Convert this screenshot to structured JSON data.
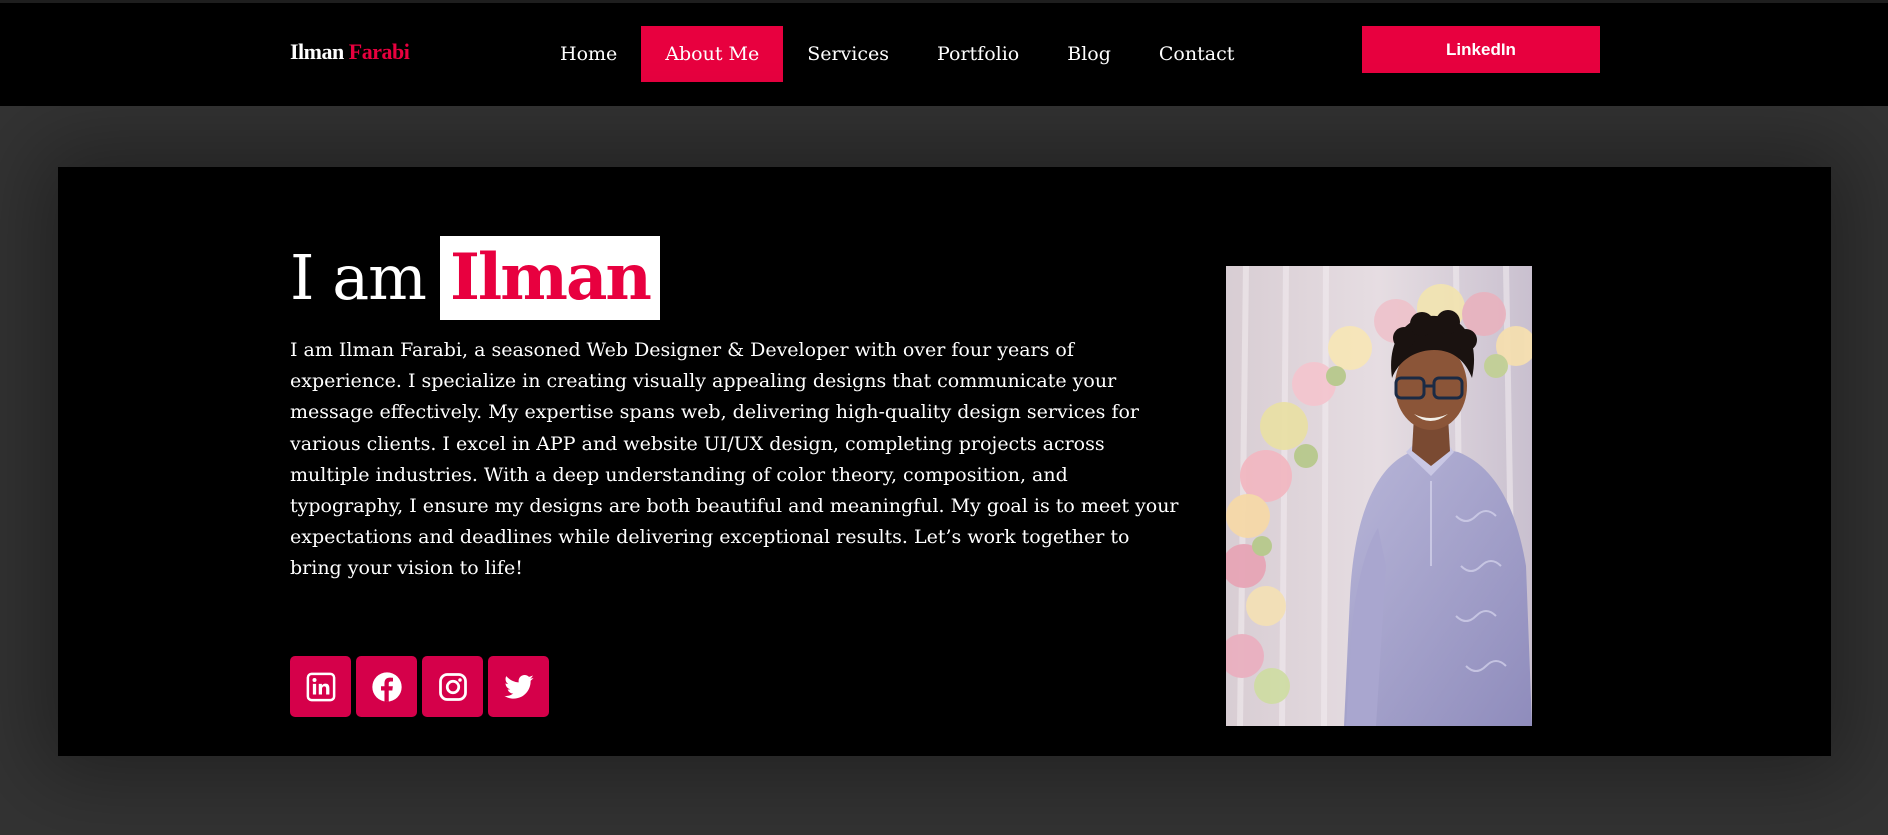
{
  "header": {
    "logo": {
      "first": "Ilman",
      "second": "Farabi"
    },
    "nav": [
      {
        "label": "Home",
        "active": false
      },
      {
        "label": "About Me",
        "active": true
      },
      {
        "label": "Services",
        "active": false
      },
      {
        "label": "Portfolio",
        "active": false
      },
      {
        "label": "Blog",
        "active": false
      },
      {
        "label": "Contact",
        "active": false
      }
    ],
    "cta_label": "LinkedIn"
  },
  "hero": {
    "heading_prefix": "I am",
    "heading_name": "Ilman",
    "bio": "I am Ilman Farabi, a seasoned Web Designer & Developer with over four years of experience. I specialize in creating visually appealing designs that communicate your message effectively. My expertise spans web, delivering high-quality design services for various clients. I excel in APP and website UI/UX design, completing projects across multiple industries. With a deep understanding of color theory, composition, and typography, I ensure my designs are both beautiful and meaningful. My goal is to meet your expectations and deadlines while delivering exceptional results. Let’s work together to bring your vision to life!",
    "socials": [
      {
        "icon": "linkedin-icon"
      },
      {
        "icon": "facebook-icon"
      },
      {
        "icon": "instagram-icon"
      },
      {
        "icon": "twitter-icon"
      }
    ],
    "photo_icon": "portrait-photo"
  },
  "colors": {
    "accent": "#e8003f",
    "social_bg": "#d5004a",
    "page_bg": "#333333",
    "panel_bg": "#000000",
    "text": "#ffffff"
  }
}
